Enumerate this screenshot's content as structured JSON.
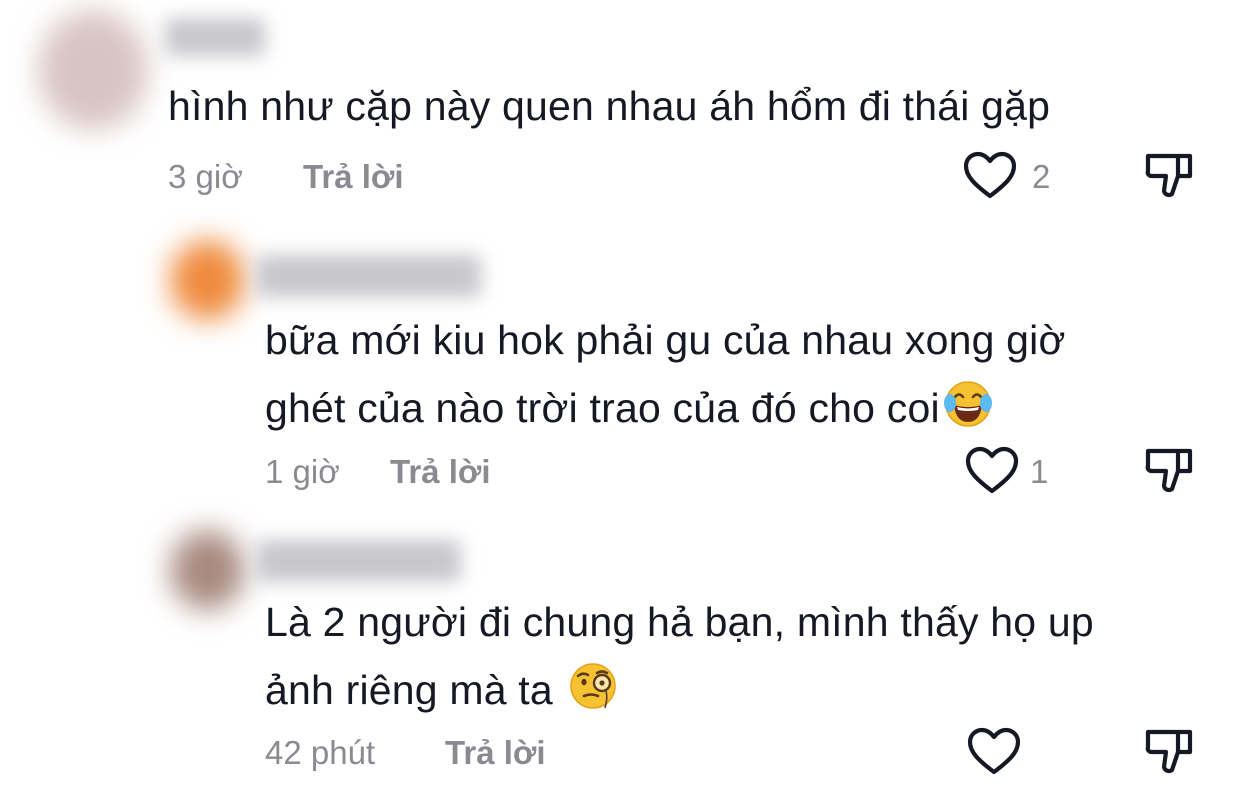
{
  "comments": [
    {
      "text_lines": [
        "hình như cặp này quen nhau áh hổm đi thái gặp"
      ],
      "time": "3 giờ",
      "reply_label": "Trả lời",
      "likes": "2"
    },
    {
      "text_lines": [
        "bữa mới kiu hok phải gu của nhau xong giờ",
        "ghét của nào trời trao của đó cho coi"
      ],
      "emoji": "tears-of-joy-emoji",
      "time": "1 giờ",
      "reply_label": "Trả lời",
      "likes": "1"
    },
    {
      "text_lines": [
        "Là 2 người đi chung hả bạn, mình thấy họ up",
        "ảnh riêng mà ta"
      ],
      "emoji": "face-with-monocle-emoji",
      "time": "42 phút",
      "reply_label": "Trả lời",
      "likes": ""
    }
  ],
  "icons": {
    "like": "heart-outline-icon",
    "dislike": "thumbs-down-outline-icon"
  },
  "colors": {
    "text": "#161823",
    "meta": "#8a8b91",
    "icon": "#161823",
    "avatar_1": "#d9c4c4",
    "avatar_2": "#ef8a3e",
    "avatar_3": "#a88a80"
  }
}
